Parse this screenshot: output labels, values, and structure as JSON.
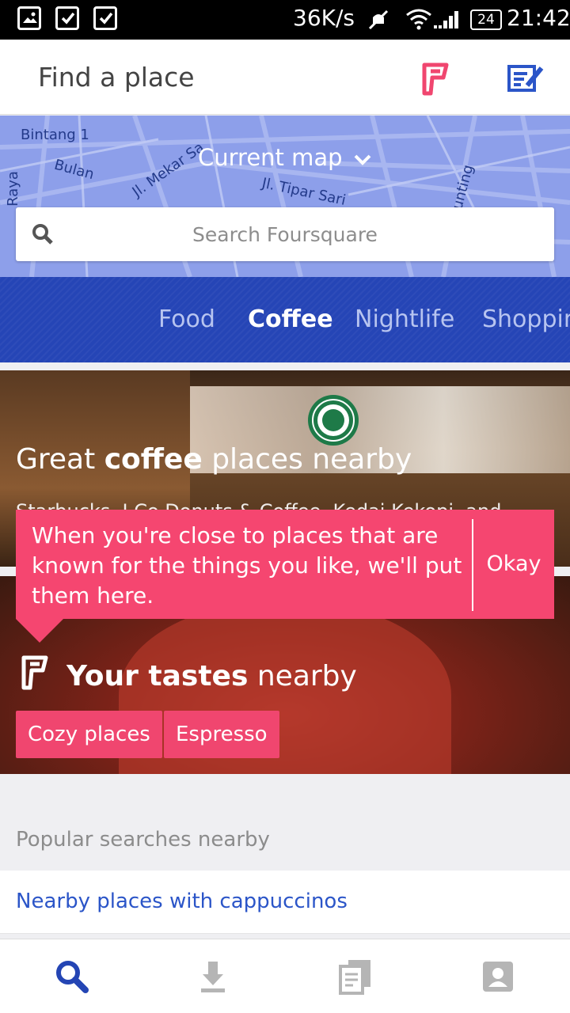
{
  "status_bar": {
    "network_speed": "36K/s",
    "battery": "24",
    "time": "21:42"
  },
  "app_bar": {
    "title": "Find a place"
  },
  "map": {
    "current_map_label": "Current map",
    "street_labels": [
      "Bintang 1",
      "Bulan",
      "Raya",
      "Jl. Mekar Sa",
      "Jl. Tipar Sari",
      "unting"
    ],
    "search_placeholder": "Search Foursquare"
  },
  "category_tabs": {
    "items": [
      "Food",
      "Coffee",
      "Nightlife",
      "Shoppin"
    ],
    "active": "Coffee"
  },
  "coffee_card": {
    "title_prefix": "Great ",
    "title_bold": "coffee",
    "title_suffix": " places nearby",
    "subtitle": "Starbucks, J.Co Donuts & Coffee, Kedai Kekopi, and"
  },
  "tooltip": {
    "message": "When you're close to places that are known for the things you like, we'll put them here.",
    "action": "Okay"
  },
  "tastes_card": {
    "title_bold": "Your tastes",
    "title_suffix": " nearby",
    "chips": [
      "Cozy places",
      "Espresso"
    ]
  },
  "popular_searches": {
    "header": "Popular searches nearby",
    "items": [
      "Nearby places with cappuccinos"
    ]
  },
  "bottom_nav": {
    "items": [
      "search-icon",
      "download-icon",
      "history-icon",
      "profile-icon"
    ],
    "active": "search-icon"
  },
  "colors": {
    "brand_pink": "#f54670",
    "brand_blue": "#2545b6",
    "link_blue": "#2b55c8",
    "map_blue": "#8d9fea"
  }
}
